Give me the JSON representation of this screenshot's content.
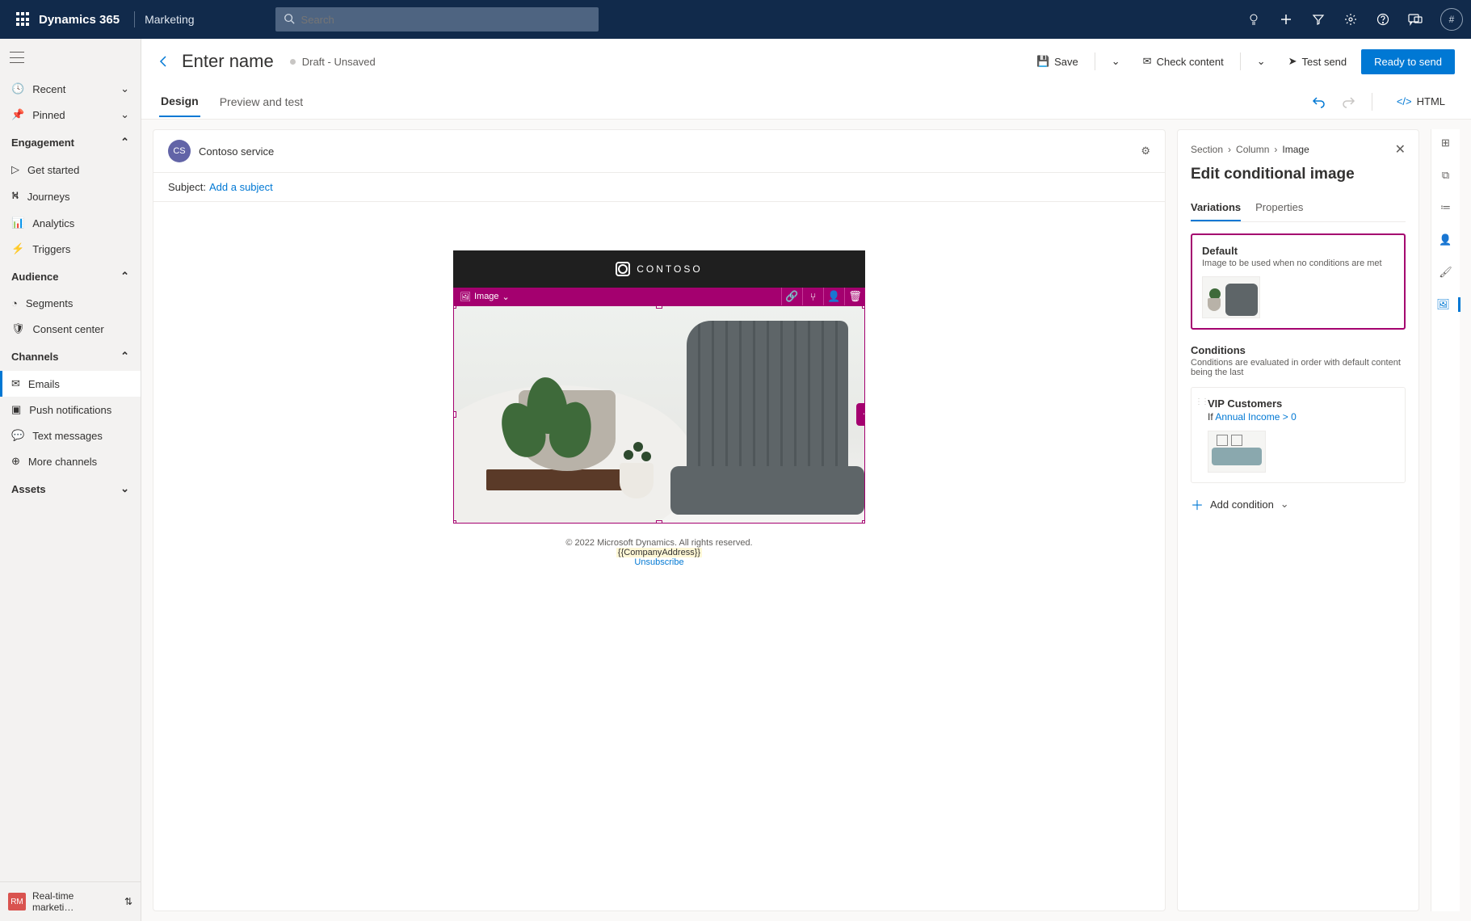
{
  "top": {
    "brand": "Dynamics 365",
    "area": "Marketing",
    "search_placeholder": "Search",
    "avatar_initial": "#"
  },
  "sidebar": {
    "quick": {
      "recent": "Recent",
      "pinned": "Pinned"
    },
    "groups": {
      "engagement": {
        "label": "Engagement",
        "items": [
          "Get started",
          "Journeys",
          "Analytics",
          "Triggers"
        ]
      },
      "audience": {
        "label": "Audience",
        "items": [
          "Segments",
          "Consent center"
        ]
      },
      "channels": {
        "label": "Channels",
        "items": [
          "Emails",
          "Push notifications",
          "Text messages",
          "More channels"
        ]
      },
      "assets": {
        "label": "Assets"
      }
    },
    "footer": {
      "badge": "RM",
      "label": "Real-time marketi…"
    }
  },
  "cmdbar": {
    "title": "Enter name",
    "status": "Draft - Unsaved",
    "save": "Save",
    "check": "Check content",
    "test": "Test send",
    "ready": "Ready to send"
  },
  "tabs": {
    "design": "Design",
    "preview": "Preview and test",
    "html": "HTML"
  },
  "sender": {
    "badge": "CS",
    "name": "Contoso service"
  },
  "subject": {
    "label": "Subject:",
    "placeholder": "Add a subject"
  },
  "hero": {
    "brand": "CONTOSO",
    "image_label": "Image"
  },
  "footer": {
    "copyright": "© 2022 Microsoft Dynamics. All rights reserved.",
    "address_token": "{{CompanyAddress}}",
    "unsubscribe": "Unsubscribe"
  },
  "panel": {
    "breadcrumb": [
      "Section",
      "Column",
      "Image"
    ],
    "title": "Edit conditional image",
    "tabs": {
      "variations": "Variations",
      "properties": "Properties"
    },
    "default": {
      "title": "Default",
      "subtitle": "Image to be used when no conditions are met"
    },
    "conditions": {
      "title": "Conditions",
      "subtitle": "Conditions are evaluated in order with default content being the last",
      "items": [
        {
          "name": "VIP Customers",
          "if_prefix": "If ",
          "expr": "Annual Income > 0"
        }
      ],
      "add": "Add condition"
    }
  }
}
